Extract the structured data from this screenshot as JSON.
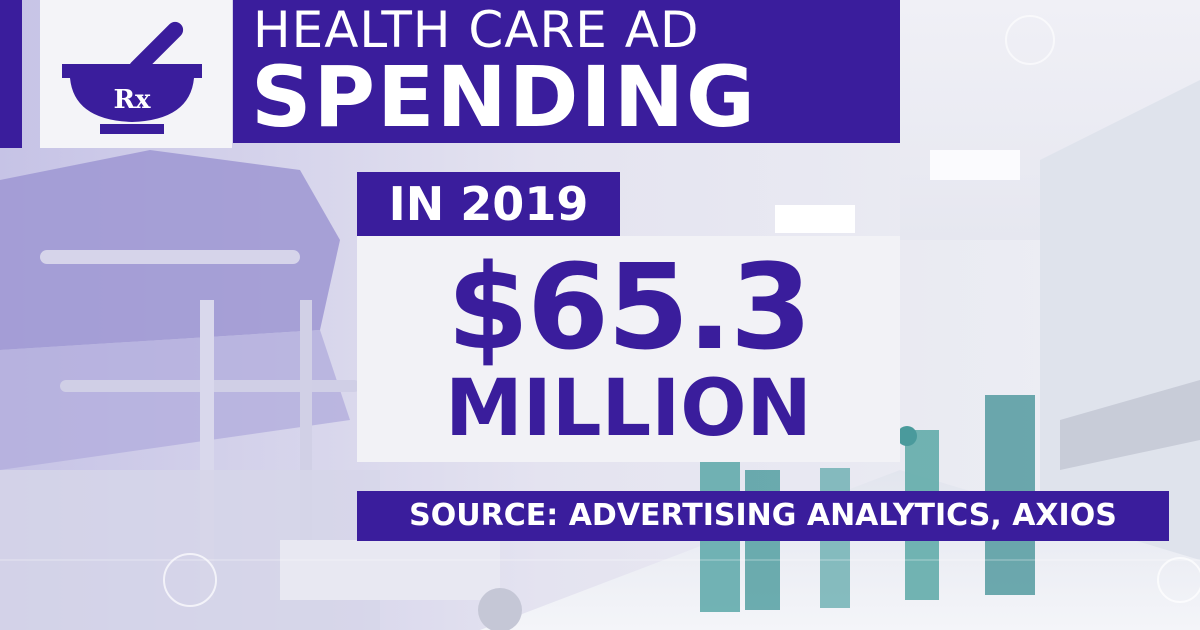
{
  "header": {
    "title_line1": "HEALTH CARE AD",
    "title_line2": "SPENDING",
    "logo_icon": "mortar-pestle-rx-icon",
    "logo_text": "Rx"
  },
  "stat": {
    "period": "IN 2019",
    "amount": "$65.3",
    "unit": "MILLION"
  },
  "source": "SOURCE: ADVERTISING ANALYTICS, AXIOS",
  "colors": {
    "brand_purple": "#3a1d9c",
    "panel_white": "#f2f2f6",
    "text_white": "#ffffff"
  }
}
